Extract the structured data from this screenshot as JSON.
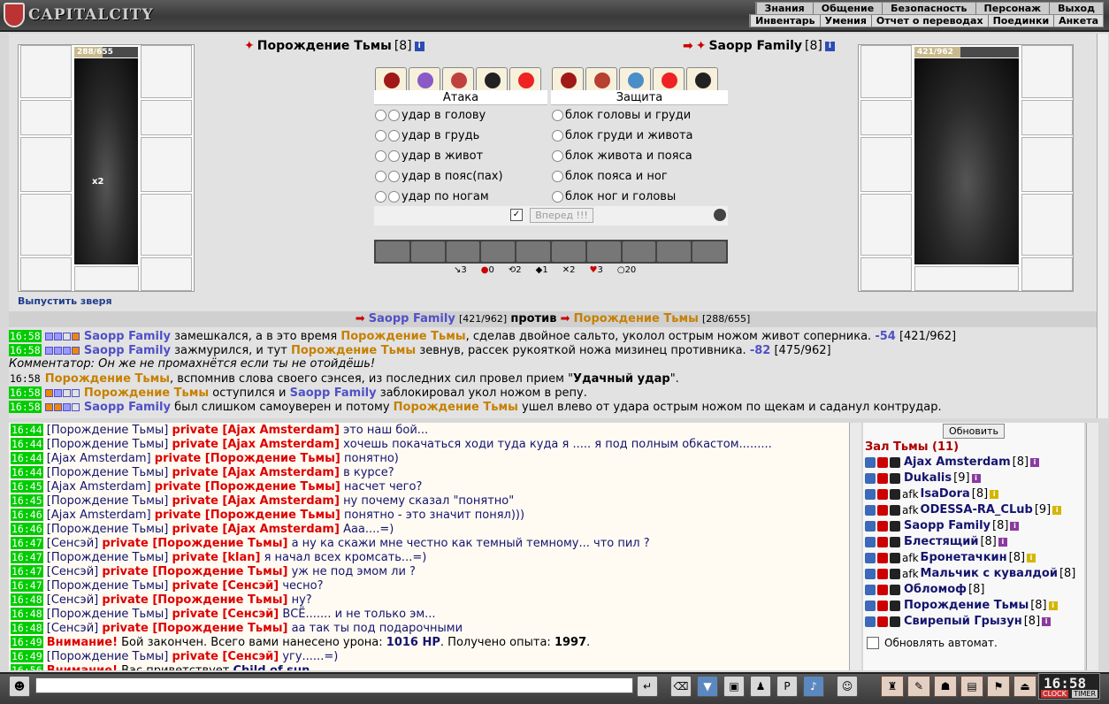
{
  "app": {
    "logo": "CAPITALCITY"
  },
  "menu_top": [
    "Знания",
    "Общение",
    "Безопасность",
    "Персонаж",
    "Выход"
  ],
  "menu_sub": [
    "Инвентарь",
    "Умения",
    "Отчет о переводах",
    "Поединки",
    "Анкета"
  ],
  "left_fighter": {
    "name": "Порождение Тьмы",
    "level": "[8]",
    "hp": "288/655",
    "hp_fraction": 0.44,
    "release_link": "Выпустить зверя",
    "count_badge": "x2"
  },
  "right_fighter": {
    "name": "Saopp Family",
    "level": "[8]",
    "hp": "421/962",
    "hp_fraction": 0.44
  },
  "attack": {
    "header": "Атака",
    "rows": [
      "удар в голову",
      "удар в грудь",
      "удар в живот",
      "удар в пояс(пах)",
      "удар по ногам"
    ]
  },
  "defense": {
    "header": "Защита",
    "rows": [
      "блок головы и груди",
      "блок груди и живота",
      "блок живота и пояса",
      "блок пояса и ног",
      "блок ног и головы"
    ]
  },
  "forward_button": "Вперед !!!",
  "stats": [
    "3",
    "0",
    "2",
    "1",
    "2",
    "3",
    "20"
  ],
  "battle_header": {
    "left": "Saopp Family",
    "left_hp": "[421/962]",
    "versus": "против",
    "right": "Порождение Тьмы",
    "right_hp": "[288/655]"
  },
  "battle_log": [
    {
      "time": "16:58",
      "a": "Saopp Family",
      "t1": " замешкался, а в это время ",
      "b": "Порождение Тьмы",
      "t2": ", сделав двойное сальто, уколол острым ножом живот соперника. ",
      "dmg": "-54",
      "hp": " [421/962]"
    },
    {
      "time": "16:58",
      "a": "Saopp Family",
      "t1": " зажмурился, и тут ",
      "b": "Порождение Тьмы",
      "t2": " зевнув, рассек рукояткой ножа мизинец противника. ",
      "dmg": "-82",
      "hp": " [475/962]"
    },
    {
      "comment": "Комментатор: Он же не промахнётся если ты не отойдёшь!"
    },
    {
      "time": "16:58",
      "a": "Порождение Тьмы",
      "t1": ", вспомнив слова своего сэнсея, из последних сил провел прием \"",
      "special": "Удачный удар",
      "t2": "\"."
    },
    {
      "time": "16:58",
      "a": "Порождение Тьмы",
      "t1": " оступился и ",
      "b": "Saopp Family",
      "t2": " заблокировал укол ножом в репу."
    },
    {
      "time": "16:58",
      "a": "Saopp Family",
      "t1": " был слишком самоуверен и потому ",
      "b": "Порождение Тьмы",
      "t2": " ушел влево от удара острым ножом по щекам и саданул контрудар."
    }
  ],
  "chat": [
    {
      "time": "16:44",
      "from": "[Порождение Тьмы]",
      "pv": "private [Ajax Amsterdam]",
      "msg": "это наш бой..."
    },
    {
      "time": "16:44",
      "from": "[Порождение Тьмы]",
      "pv": "private [Ajax Amsterdam]",
      "msg": "хочешь покачаться ходи туда куда я ..... я под полным обкастом........."
    },
    {
      "time": "16:44",
      "from": "[Ajax Amsterdam]",
      "pv": "private [Порождение Тьмы]",
      "msg": "понятно)"
    },
    {
      "time": "16:44",
      "from": "[Порождение Тьмы]",
      "pv": "private [Ajax Amsterdam]",
      "msg": "в курсе?"
    },
    {
      "time": "16:45",
      "from": "[Ajax Amsterdam]",
      "pv": "private [Порождение Тьмы]",
      "msg": "насчет чего?"
    },
    {
      "time": "16:45",
      "from": "[Порождение Тьмы]",
      "pv": "private [Ajax Amsterdam]",
      "msg": "ну почему сказал \"понятно\""
    },
    {
      "time": "16:46",
      "from": "[Ajax Amsterdam]",
      "pv": "private [Порождение Тьмы]",
      "msg": "понятно - это значит понял)))"
    },
    {
      "time": "16:46",
      "from": "[Порождение Тьмы]",
      "pv": "private [Ajax Amsterdam]",
      "msg": "Ааа....=)"
    },
    {
      "time": "16:47",
      "from": "[Сенсэй]",
      "pv": "private [Порождение Тьмы]",
      "msg": "а ну ка скажи мне честно как темный темному... что пил ?"
    },
    {
      "time": "16:47",
      "from": "[Порождение Тьмы]",
      "pv": "private [klan]",
      "msg": "я начал всех кромсать...=)"
    },
    {
      "time": "16:47",
      "from": "[Сенсэй]",
      "pv": "private [Порождение Тьмы]",
      "msg": "уж не под эмом ли ?"
    },
    {
      "time": "16:47",
      "from": "[Порождение Тьмы]",
      "pv": "private [Сенсэй]",
      "msg": "чесно?"
    },
    {
      "time": "16:48",
      "from": "[Сенсэй]",
      "pv": "private [Порождение Тьмы]",
      "msg": "ну?"
    },
    {
      "time": "16:48",
      "from": "[Порождение Тьмы]",
      "pv": "private [Сенсэй]",
      "msg": "ВСЁ....... и не только эм..."
    },
    {
      "time": "16:48",
      "from": "[Сенсэй]",
      "pv": "private [Порождение Тьмы]",
      "msg": "аа так ты под подарочными"
    },
    {
      "time": "16:49",
      "sys": true,
      "warn": "Внимание!",
      "msg": " Бой закончен. Всего вами нанесено урона: ",
      "v1": "1016 HP",
      "msg2": ". Получено опыта: ",
      "v2": "1997",
      "msg3": "."
    },
    {
      "time": "16:49",
      "from": "[Порождение Тьмы]",
      "pv": "private [Сенсэй]",
      "msg": "угу......=)"
    },
    {
      "time": "16:56",
      "sys": true,
      "warn": "Внимание!",
      "msg": " Вас приветствует ",
      "v1": "Child of sun",
      "msg2": "",
      "v2": "",
      "msg3": ""
    }
  ],
  "roster": {
    "refresh": "Обновить",
    "title": "Зал Тьмы (11)",
    "users": [
      {
        "afk": "",
        "name": "Ajax Amsterdam",
        "lvl": "[8]",
        "badge": "ip"
      },
      {
        "afk": "",
        "name": "Dukalis",
        "lvl": "[9]",
        "badge": "ip"
      },
      {
        "afk": "afk ",
        "name": "IsaDora",
        "lvl": "[8]",
        "badge": "iy"
      },
      {
        "afk": "afk ",
        "name": "ODESSA-RA_CLub",
        "lvl": "[9]",
        "badge": "iy"
      },
      {
        "afk": "",
        "name": "Saopp Family",
        "lvl": "[8]",
        "badge": "ip"
      },
      {
        "afk": "",
        "name": "Блестящий",
        "lvl": "[8]",
        "badge": "ip"
      },
      {
        "afk": "afk ",
        "name": "Бронетачкин",
        "lvl": "[8]",
        "badge": "iy"
      },
      {
        "afk": "afk ",
        "name": "Мальчик с кувалдой",
        "lvl": "[8]",
        "badge": ""
      },
      {
        "afk": "",
        "name": "Обломоф",
        "lvl": "[8]",
        "badge": ""
      },
      {
        "afk": "",
        "name": "Порождение Тьмы",
        "lvl": "[8]",
        "badge": "iy"
      },
      {
        "afk": "",
        "name": "Свирепый Грызун",
        "lvl": "[8]",
        "badge": "ip"
      }
    ],
    "auto": "Обновлять автомат."
  },
  "clock": {
    "time": "16:58",
    "clock_label": "CLOCK",
    "timer_label": "TIMER"
  },
  "colors": {
    "accent_blue": "#5050c8",
    "accent_orange": "#c68000",
    "time_green": "#00cc00",
    "private_red": "#dd0000"
  },
  "icons": [
    "inventory-icon",
    "map-icon",
    "bag-icon",
    "chat-icon",
    "settings-icon",
    "emote-icon",
    "exit-icon"
  ]
}
